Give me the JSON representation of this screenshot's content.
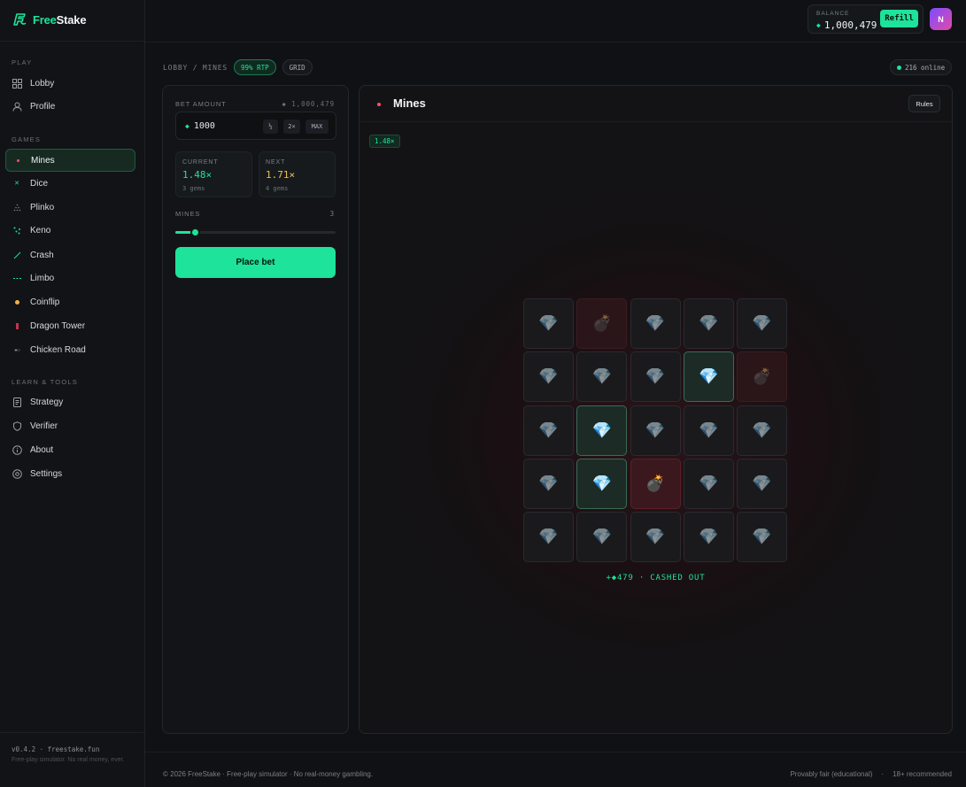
{
  "app": {
    "name_part1": "Free",
    "name_part2": "Stake"
  },
  "sidebar": {
    "sections": [
      {
        "label": "PLAY"
      },
      {
        "label": "GAMES"
      },
      {
        "label": "LEARN & TOOLS"
      }
    ],
    "play_items": [
      {
        "label": "Lobby",
        "icon": "grid-icon"
      },
      {
        "label": "Profile",
        "icon": "user-icon"
      }
    ],
    "game_items": [
      {
        "label": "Mines",
        "icon": "mine-dot-icon",
        "active": true
      },
      {
        "label": "Dice",
        "icon": "dice-icon"
      },
      {
        "label": "Plinko",
        "icon": "plinko-icon"
      },
      {
        "label": "Keno",
        "icon": "keno-icon"
      },
      {
        "label": "Crash",
        "icon": "crash-icon"
      },
      {
        "label": "Limbo",
        "icon": "limbo-icon"
      },
      {
        "label": "Coinflip",
        "icon": "coin-icon"
      },
      {
        "label": "Dragon Tower",
        "icon": "dragon-tower-icon"
      },
      {
        "label": "Chicken Road",
        "icon": "chicken-road-icon"
      }
    ],
    "tool_items": [
      {
        "label": "Strategy",
        "icon": "strategy-icon"
      },
      {
        "label": "Verifier",
        "icon": "shield-icon"
      },
      {
        "label": "About",
        "icon": "info-icon"
      },
      {
        "label": "Settings",
        "icon": "gear-icon"
      }
    ],
    "version": "v0.4.2 · freestake.fun",
    "note": "Free-play simulator. No real money, ever."
  },
  "topbar": {
    "balance_label": "BALANCE",
    "balance_value": "1,000,479",
    "refill_label": "Refill",
    "avatar_initial": "N"
  },
  "breadcrumb": {
    "path": "LOBBY / MINES",
    "rtp": "99% RTP",
    "mode": "GRID",
    "online": "216 online"
  },
  "controls": {
    "bet_label": "BET AMOUNT",
    "bet_balance": "◆ 1,000,479",
    "bet_value": "1000",
    "half_label": "½",
    "double_label": "2×",
    "max_label": "MAX",
    "current_label": "CURRENT",
    "current_value": "1.48×",
    "current_sub": "3 gems",
    "next_label": "NEXT",
    "next_value": "1.71×",
    "next_sub": "4 gems",
    "mines_label": "MINES",
    "mines_value": "3",
    "mines_fraction": 0.12,
    "place_bet_label": "Place bet"
  },
  "game": {
    "title": "Mines",
    "rules_label": "Rules",
    "multiplier_chip": "1.48×",
    "tiles": [
      [
        "gem",
        "bomb",
        "gem",
        "gem",
        "gem"
      ],
      [
        "gem",
        "gem",
        "gem",
        "gem-revealed",
        "bomb"
      ],
      [
        "gem",
        "gem-revealed",
        "gem",
        "gem",
        "gem"
      ],
      [
        "gem",
        "gem-revealed",
        "bomb-hit",
        "gem",
        "gem"
      ],
      [
        "gem",
        "gem",
        "gem",
        "gem",
        "gem"
      ]
    ],
    "cashout_text": "+◆479 · CASHED OUT"
  },
  "footer": {
    "left": "© 2026 FreeStake · Free-play simulator · No real-money gambling.",
    "right_1": "Provably fair (educational)",
    "sep": "·",
    "right_2": "18+ recommended"
  },
  "colors": {
    "accent": "#1ee39a",
    "danger": "#ff4d6d",
    "next": "#e8c24a"
  }
}
